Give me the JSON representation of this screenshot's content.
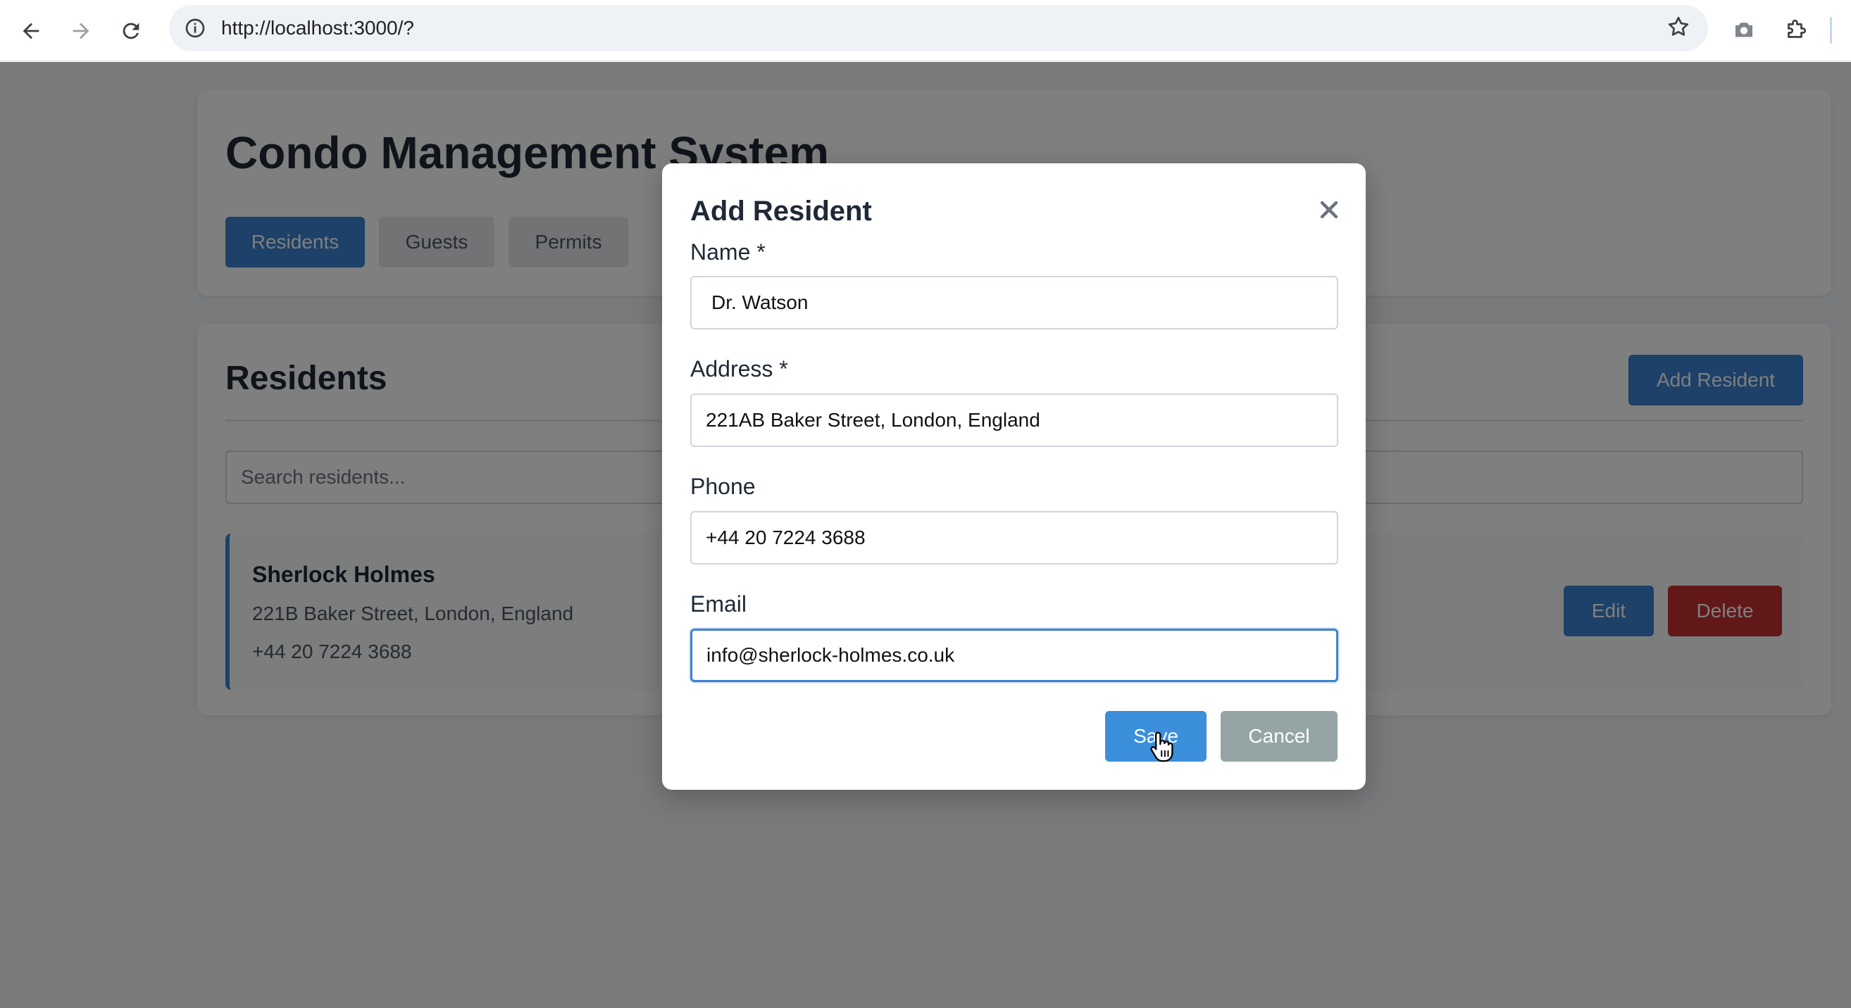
{
  "browser": {
    "url": "http://localhost:3000/?"
  },
  "app": {
    "title": "Condo Management System",
    "tabs": [
      {
        "label": "Residents",
        "active": true
      },
      {
        "label": "Guests",
        "active": false
      },
      {
        "label": "Permits",
        "active": false
      }
    ]
  },
  "residents_section": {
    "title": "Residents",
    "add_button_label": "Add Resident",
    "search_placeholder": "Search residents...",
    "rows": [
      {
        "name": "Sherlock Holmes",
        "address": "221B Baker Street, London, England",
        "phone": "+44 20 7224 3688",
        "edit_label": "Edit",
        "delete_label": "Delete"
      }
    ]
  },
  "modal": {
    "title": "Add Resident",
    "fields": {
      "name": {
        "label": "Name *",
        "value": "Dr. Watson"
      },
      "address": {
        "label": "Address *",
        "value": "221AB Baker Street, London, England"
      },
      "phone": {
        "label": "Phone",
        "value": "+44 20 7224 3688"
      },
      "email": {
        "label": "Email",
        "value": "info@sherlock-holmes.co.uk"
      }
    },
    "save_label": "Save",
    "cancel_label": "Cancel"
  },
  "colors": {
    "primary": "#3b82d0",
    "danger": "#c53030",
    "secondary": "#95a5a6",
    "focus": "#3b82d0"
  }
}
